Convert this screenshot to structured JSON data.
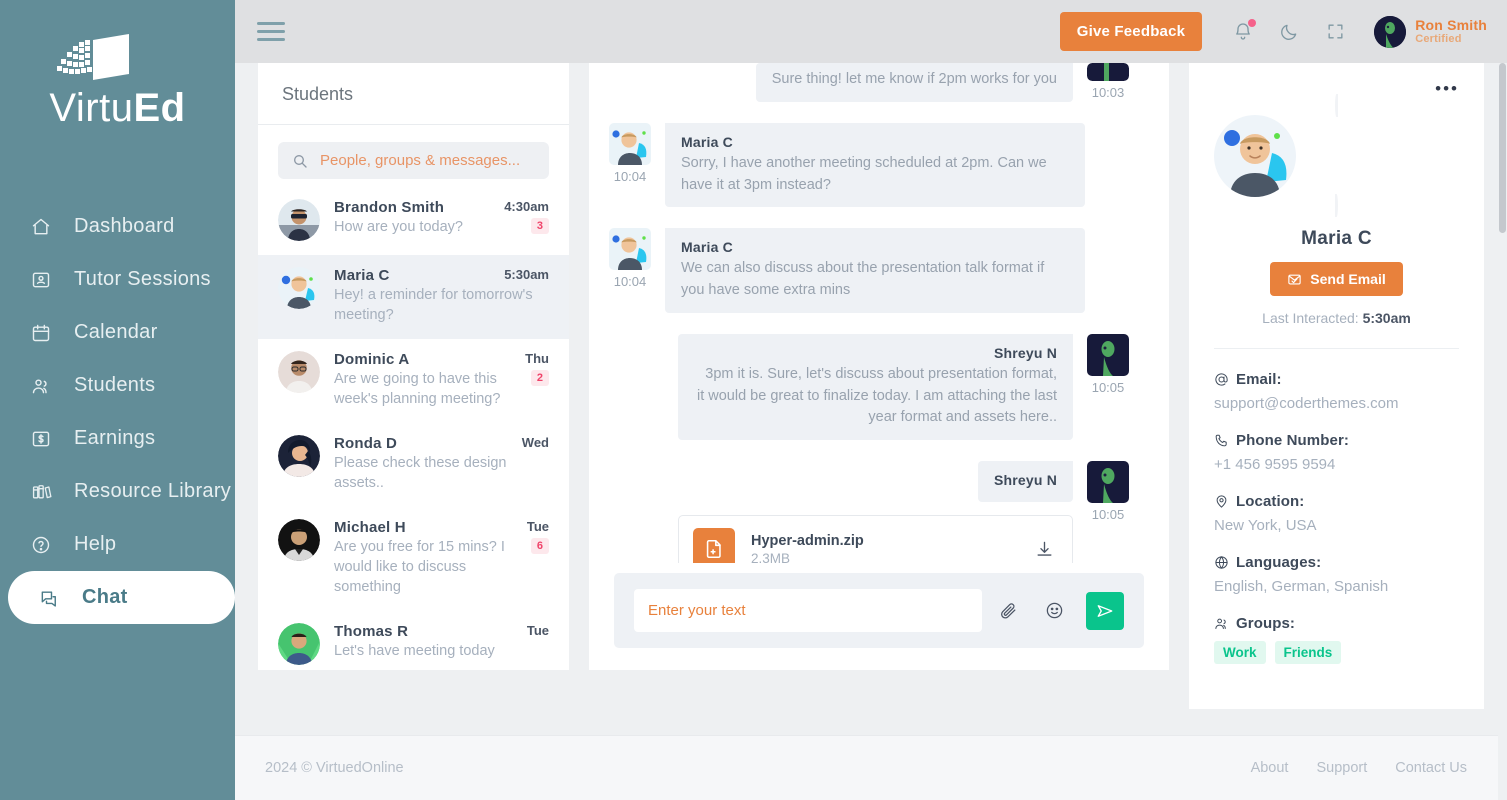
{
  "brand": {
    "name_thin": "Virtu",
    "name_bold": "Ed",
    "logo_icon": "book-logo-icon"
  },
  "sidebar": {
    "items": [
      {
        "label": "Dashboard",
        "icon": "home-icon",
        "active": false
      },
      {
        "label": "Tutor Sessions",
        "icon": "id-card-icon",
        "active": false
      },
      {
        "label": "Calendar",
        "icon": "calendar-icon",
        "active": false
      },
      {
        "label": "Students",
        "icon": "users-icon",
        "active": false
      },
      {
        "label": "Earnings",
        "icon": "dollar-box-icon",
        "active": false
      },
      {
        "label": "Resource Library",
        "icon": "books-icon",
        "active": false
      },
      {
        "label": "Help",
        "icon": "question-circle-icon",
        "active": false
      },
      {
        "label": "Chat",
        "icon": "chat-bubbles-icon",
        "active": true
      }
    ]
  },
  "topbar": {
    "menu_icon": "hamburger-icon",
    "feedback_label": "Give Feedback",
    "bell_icon": "bell-icon",
    "has_notification": true,
    "theme_icon": "moon-icon",
    "fullscreen_icon": "fullscreen-icon",
    "user": {
      "name": "Ron Smith",
      "role": "Certified",
      "avatar": "avatar-ron-smith"
    }
  },
  "chat_list": {
    "title": "Students",
    "search": {
      "placeholder": "People, groups & messages...",
      "value": "",
      "icon": "search-icon"
    },
    "items": [
      {
        "name": "Brandon Smith",
        "time": "4:30am",
        "message": "How are you today?",
        "badge": "3",
        "selected": false,
        "online": false
      },
      {
        "name": "Maria C",
        "time": "5:30am",
        "message": "Hey! a reminder for tomorrow's meeting?",
        "badge": "",
        "selected": true,
        "online": true
      },
      {
        "name": "Dominic A",
        "time": "Thu",
        "message": "Are we going to have this week's planning meeting?",
        "badge": "2",
        "selected": false,
        "online": false
      },
      {
        "name": "Ronda D",
        "time": "Wed",
        "message": "Please check these design assets..",
        "badge": "",
        "selected": false,
        "online": false
      },
      {
        "name": "Michael H",
        "time": "Tue",
        "message": "Are you free for 15 mins? I would like to discuss something",
        "badge": "6",
        "selected": false,
        "online": false
      },
      {
        "name": "Thomas R",
        "time": "Tue",
        "message": "Let's have meeting today",
        "badge": "",
        "selected": false,
        "online": false
      }
    ]
  },
  "conversation": {
    "messages": [
      {
        "direction": "out",
        "sender": "",
        "text": "Sure thing! let me know if 2pm works for you",
        "time": "10:03",
        "type": "text",
        "show_name": false
      },
      {
        "direction": "in",
        "sender": "Maria C",
        "text": "Sorry, I have another meeting scheduled at 2pm. Can we have it at 3pm instead?",
        "time": "10:04",
        "type": "text",
        "show_name": true
      },
      {
        "direction": "in",
        "sender": "Maria C",
        "text": "We can also discuss about the presentation talk format if you have some extra mins",
        "time": "10:04",
        "type": "text",
        "show_name": true
      },
      {
        "direction": "out",
        "sender": "Shreyu N",
        "text": "3pm it is. Sure, let's discuss about presentation format, it would be great to finalize today. I am attaching the last year format and assets here..",
        "time": "10:05",
        "type": "text",
        "show_name": true
      },
      {
        "direction": "out",
        "sender": "Shreyu N",
        "text": "",
        "time": "10:05",
        "type": "file",
        "show_name": true,
        "file": {
          "name": "Hyper-admin.zip",
          "size": "2.3MB",
          "icon": "file-zip-icon",
          "download_icon": "download-icon"
        }
      }
    ],
    "composer": {
      "placeholder": "Enter your text",
      "value": "",
      "attach_icon": "paperclip-icon",
      "emoji_icon": "emoji-icon",
      "send_icon": "send-icon"
    }
  },
  "profile_panel": {
    "more_icon": "more-horizontal-icon",
    "avatar": "avatar-maria-c",
    "name": "Maria C",
    "email_button": {
      "label": "Send Email",
      "icon": "envelope-check-icon"
    },
    "last_interacted_label": "Last Interacted:",
    "last_interacted_value": "5:30am",
    "fields": [
      {
        "icon": "at-icon",
        "label": "Email:",
        "value": "support@coderthemes.com"
      },
      {
        "icon": "phone-icon",
        "label": "Phone Number:",
        "value": "+1 456 9595 9594"
      },
      {
        "icon": "map-pin-icon",
        "label": "Location:",
        "value": "New York, USA"
      },
      {
        "icon": "globe-icon",
        "label": "Languages:",
        "value": "English, German, Spanish"
      }
    ],
    "groups": {
      "icon": "users-icon",
      "label": "Groups:",
      "tags": [
        "Work",
        "Friends"
      ]
    }
  },
  "footer": {
    "copyright": "2024 © VirtuedOnline",
    "links": [
      "About",
      "Support",
      "Contact Us"
    ]
  },
  "colors": {
    "sidebar": "#628d98",
    "accent_orange": "#e8813c",
    "accent_green": "#0ac48c",
    "badge_red": "#f0436a",
    "topbar": "#dfe0e2"
  }
}
